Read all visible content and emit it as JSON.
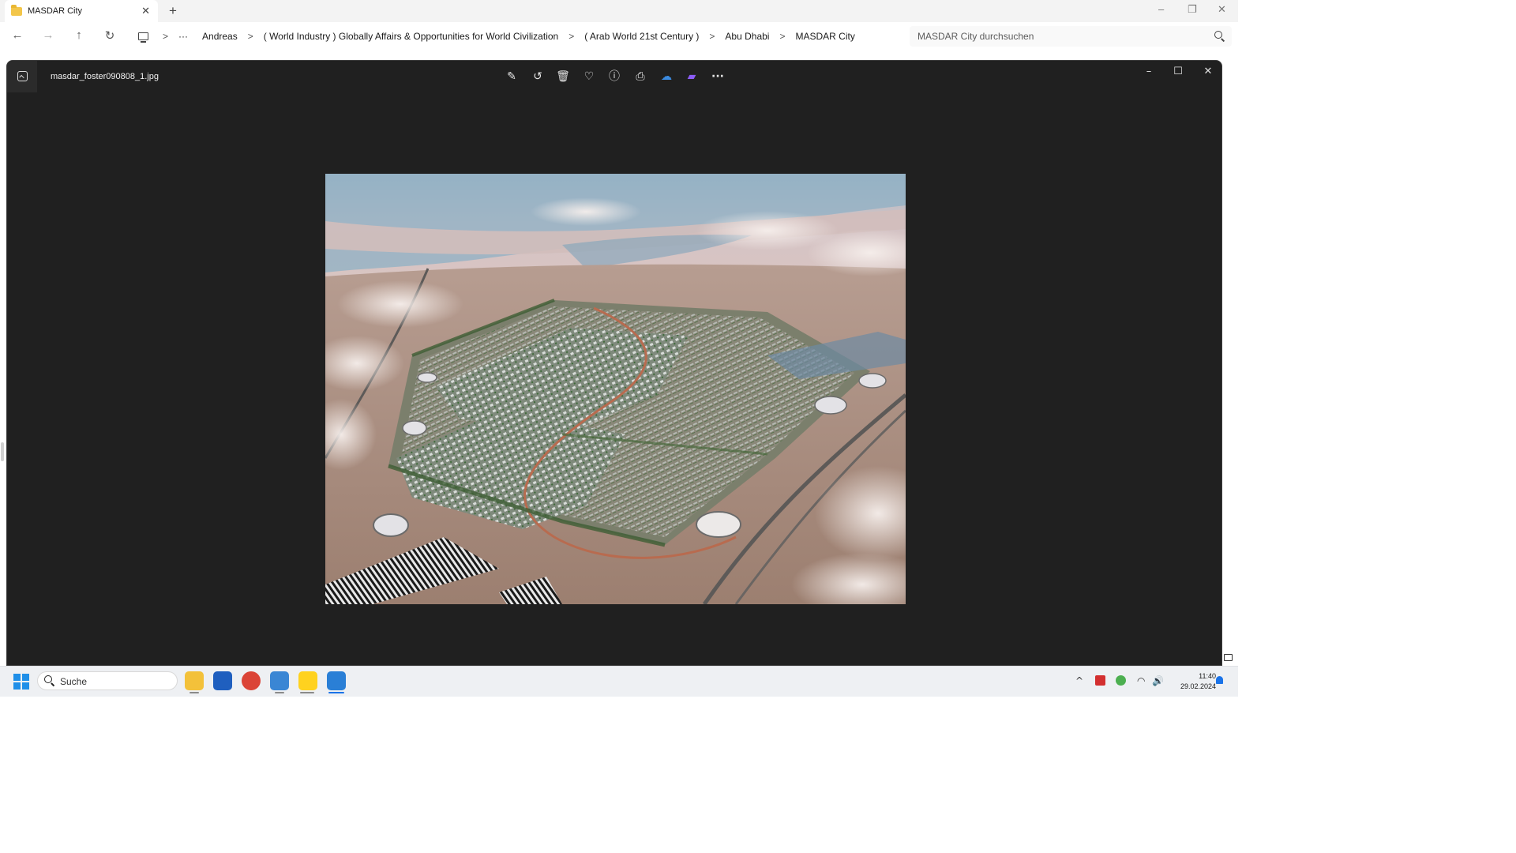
{
  "explorer": {
    "tab_title": "MASDAR City",
    "tab_close_glyph": "✕",
    "new_tab_glyph": "+",
    "window_controls": [
      "–",
      "❐",
      "✕"
    ],
    "nav": {
      "back_glyph": "←",
      "forward_glyph": "→",
      "up_glyph": "↑",
      "refresh_glyph": "↻",
      "overflow_glyph": "···"
    },
    "breadcrumb": [
      "Andreas",
      "( World Industry ) Globally Affairs & Opportunities for World Civilization",
      "( Arab World 21st Century )",
      "Abu Dhabi",
      "MASDAR City"
    ],
    "breadcrumb_separator": ">",
    "search_placeholder": "MASDAR City durchsuchen"
  },
  "viewer": {
    "file_name": "masdar_foster090808_1.jpg",
    "toolbar": [
      {
        "name": "edit-image-icon",
        "glyph": "✎"
      },
      {
        "name": "rotate-icon",
        "glyph": "↺"
      },
      {
        "name": "delete-icon",
        "glyph": "🗑"
      },
      {
        "name": "favorite-icon",
        "glyph": "♡"
      },
      {
        "name": "info-icon",
        "glyph": "ⓘ"
      },
      {
        "name": "print-icon",
        "glyph": "⎙"
      },
      {
        "name": "onedrive-icon",
        "glyph": "☁"
      },
      {
        "name": "clipchamp-icon",
        "glyph": "▰"
      },
      {
        "name": "more-options-icon",
        "glyph": "···"
      }
    ],
    "window_controls": [
      "–",
      "☐",
      "✕"
    ],
    "image_subject": "aerial rendering of Masdar City in desert"
  },
  "taskbar": {
    "search_label": "Suche",
    "apps": [
      {
        "name": "file-explorer-icon",
        "color": "#f3c13a",
        "active": true
      },
      {
        "name": "microsoft-store-icon",
        "color": "#1f5fbf",
        "active": false
      },
      {
        "name": "chrome-icon",
        "color": "#db4437",
        "active": false
      },
      {
        "name": "notepad-icon",
        "color": "#3a86d4",
        "active": true
      },
      {
        "name": "player-icon",
        "color": "#ffd21f",
        "active": true
      },
      {
        "name": "photos-icon",
        "color": "#2a7fd6",
        "active": true
      }
    ],
    "tray": {
      "chevron_glyph": "^",
      "wifi_glyph": "◠",
      "volume_glyph": "🔊",
      "time": "11:40",
      "date": "29.02.2024"
    }
  },
  "colors": {
    "viewer_bg": "#202020",
    "accent": "#1f8fe8"
  }
}
